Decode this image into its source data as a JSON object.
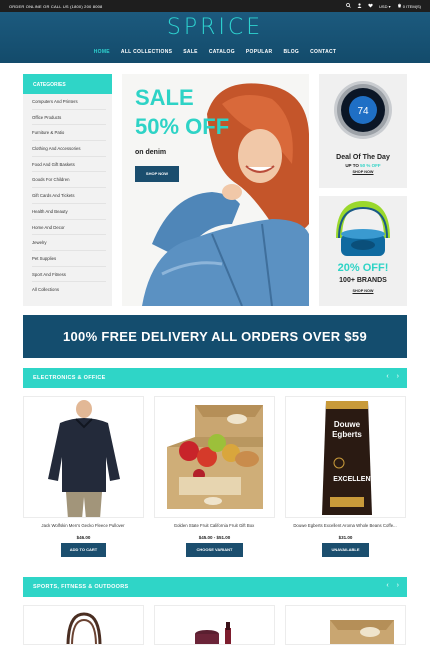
{
  "topbar": {
    "phone": "ORDER ONLINE OR CALL US (1800) 200 8008",
    "currency": "USD",
    "cart": "0 ITEM(S)"
  },
  "header": {
    "logo": "SPRICE",
    "nav": [
      "HOME",
      "ALL COLLECTIONS",
      "SALE",
      "CATALOG",
      "POPULAR",
      "BLOG",
      "CONTACT"
    ],
    "active": "HOME"
  },
  "categories": {
    "title": "CATEGORIES",
    "items": [
      "Computers And Printers",
      "Office Products",
      "Furniture & Patio",
      "Clothing And Accessories",
      "Food And Gift Baskets",
      "Goods For Children",
      "Gift Cards And Tickets",
      "Health And Beauty",
      "Home And Decor",
      "Jewelry",
      "Pet Supplies",
      "Sport And Fitness",
      "All Collections"
    ]
  },
  "hero": {
    "line1": "SALE",
    "line2": "50% OFF",
    "line3": "on denim",
    "button": "SHOP NOW"
  },
  "deal": {
    "title": "Deal Of The Day",
    "subtitle_prefix": "UP TO",
    "subtitle_highlight": "50 % OFF",
    "link": "SHOP NOW",
    "thermostat_value": "74"
  },
  "brands": {
    "discount": "20% OFF!",
    "brands": "100+ BRANDS",
    "link": "SHOP NOW"
  },
  "banner": {
    "text": "100% FREE DELIVERY ALL ORDERS OVER $59"
  },
  "sections": [
    {
      "title": "ELECTRONICS & OFFICE",
      "products": [
        {
          "name": "Jack Wolfskin Men's Gecko Fleece Pullover",
          "price": "$46.00",
          "button": "ADD TO CART"
        },
        {
          "name": "Golden State Fruit California Fruit Gift Box",
          "price": "$45.00 - $51.00",
          "button": "CHOOSE VARIANT"
        },
        {
          "name": "Douwe Egberts Excellent Aroma Whole Beans Coffe...",
          "price": "$31.00",
          "button": "UNAVAILABLE"
        }
      ]
    },
    {
      "title": "SPORTS, FITNESS & OUTDOORS"
    }
  ],
  "colors": {
    "accent": "#2fd5c7",
    "navy": "#144d6e",
    "topbar": "#1e1e1e"
  }
}
